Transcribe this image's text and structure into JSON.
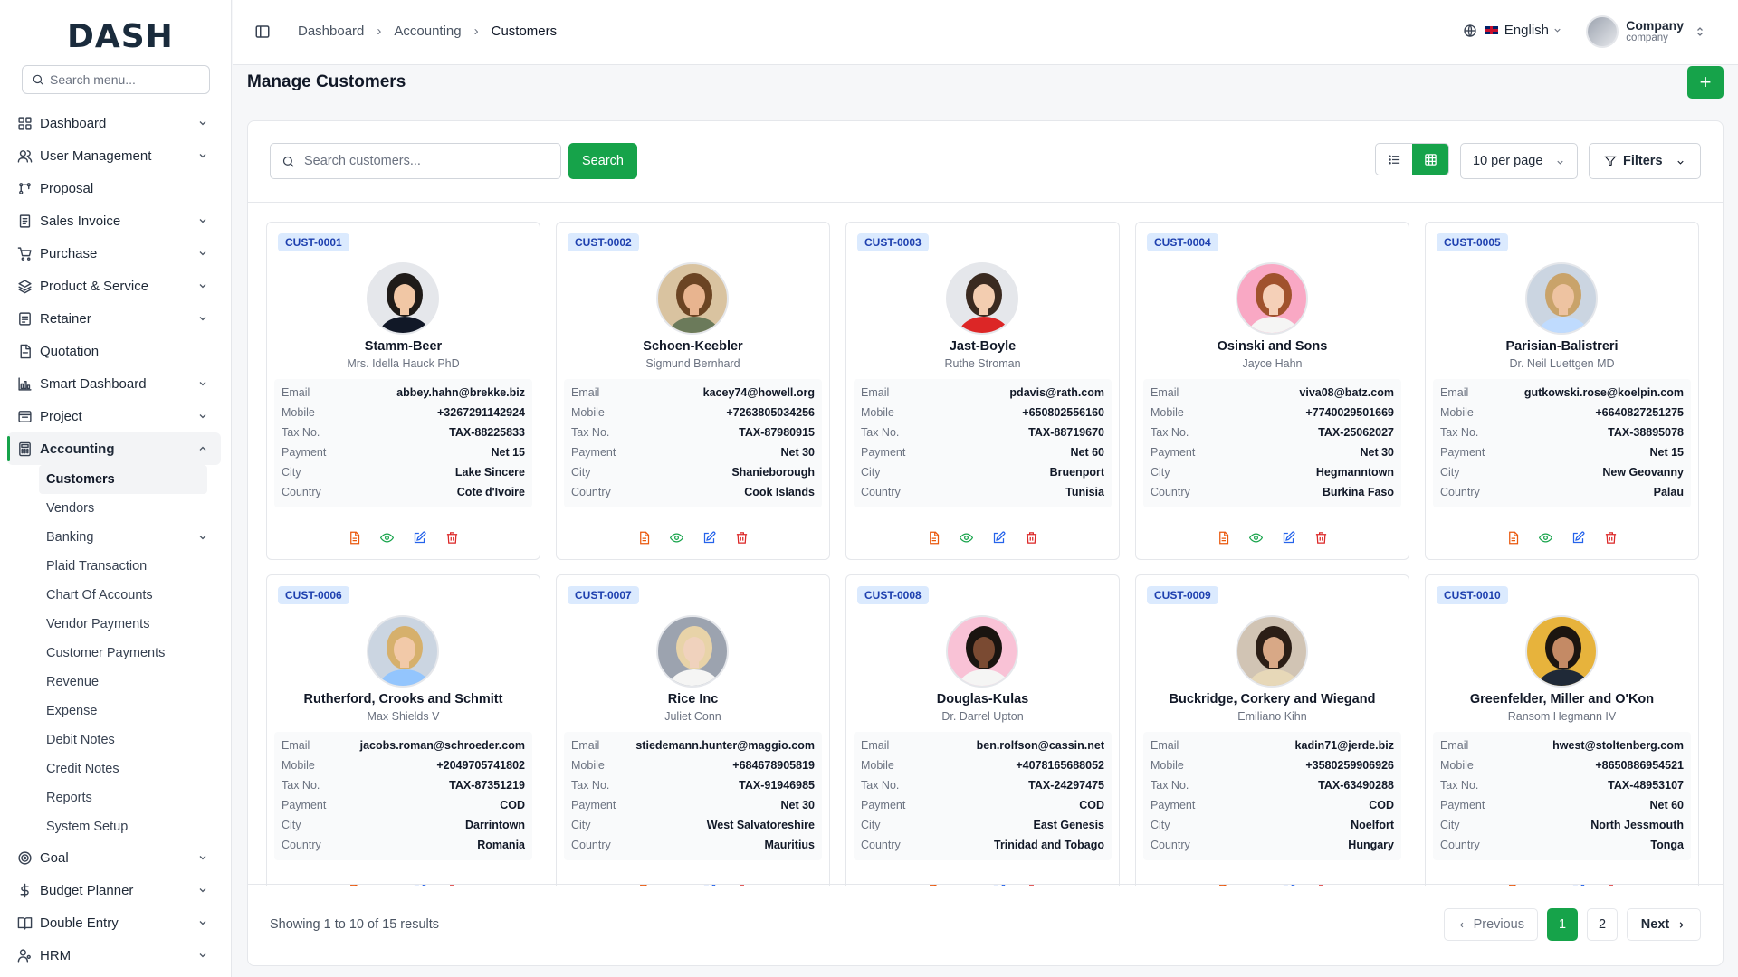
{
  "sidebar": {
    "logo": "DASH",
    "search_placeholder": "Search menu...",
    "items": [
      {
        "label": "Dashboard",
        "icon": "grid-icon",
        "chevron": true
      },
      {
        "label": "User Management",
        "icon": "users-icon",
        "chevron": true
      },
      {
        "label": "Proposal",
        "icon": "proposal-icon",
        "chevron": false
      },
      {
        "label": "Sales Invoice",
        "icon": "invoice-icon",
        "chevron": true
      },
      {
        "label": "Purchase",
        "icon": "cart-icon",
        "chevron": true
      },
      {
        "label": "Product & Service",
        "icon": "layers-icon",
        "chevron": true
      },
      {
        "label": "Retainer",
        "icon": "retainer-icon",
        "chevron": true
      },
      {
        "label": "Quotation",
        "icon": "quotation-icon",
        "chevron": false
      },
      {
        "label": "Smart Dashboard",
        "icon": "chart-icon",
        "chevron": true
      },
      {
        "label": "Project",
        "icon": "project-icon",
        "chevron": true
      },
      {
        "label": "Accounting",
        "icon": "accounting-icon",
        "chevron": true
      }
    ],
    "accounting_sub": [
      {
        "label": "Customers",
        "active": true
      },
      {
        "label": "Vendors"
      },
      {
        "label": "Banking",
        "chevron": true
      },
      {
        "label": "Plaid Transaction"
      },
      {
        "label": "Chart Of Accounts"
      },
      {
        "label": "Vendor Payments"
      },
      {
        "label": "Customer Payments"
      },
      {
        "label": "Revenue"
      },
      {
        "label": "Expense"
      },
      {
        "label": "Debit Notes"
      },
      {
        "label": "Credit Notes"
      },
      {
        "label": "Reports"
      },
      {
        "label": "System Setup"
      }
    ],
    "items_after": [
      {
        "label": "Goal",
        "icon": "goal-icon"
      },
      {
        "label": "Budget Planner",
        "icon": "dollar-icon"
      },
      {
        "label": "Double Entry",
        "icon": "book-icon"
      },
      {
        "label": "HRM",
        "icon": "hrm-icon"
      }
    ]
  },
  "topbar": {
    "breadcrumbs": [
      "Dashboard",
      "Accounting",
      "Customers"
    ],
    "language": "English",
    "company_name": "Company",
    "company_sub": "company"
  },
  "page": {
    "title": "Manage Customers",
    "add_label": "+",
    "search_placeholder": "Search customers...",
    "search_button": "Search",
    "per_page": "10 per page",
    "filters": "Filters"
  },
  "labels": {
    "email": "Email",
    "mobile": "Mobile",
    "tax": "Tax No.",
    "payment": "Payment",
    "city": "City",
    "country": "Country"
  },
  "customers": [
    {
      "id": "CUST-0001",
      "name": "Stamm-Beer",
      "contact": "Mrs. Idella Hauck PhD",
      "email": "abbey.hahn@brekke.biz",
      "mobile": "+3267291142924",
      "tax": "TAX-88225833",
      "payment": "Net 15",
      "city": "Lake Sincere",
      "country": "Cote d'Ivoire"
    },
    {
      "id": "CUST-0002",
      "name": "Schoen-Keebler",
      "contact": "Sigmund Bernhard",
      "email": "kacey74@howell.org",
      "mobile": "+7263805034256",
      "tax": "TAX-87980915",
      "payment": "Net 30",
      "city": "Shanieborough",
      "country": "Cook Islands"
    },
    {
      "id": "CUST-0003",
      "name": "Jast-Boyle",
      "contact": "Ruthe Stroman",
      "email": "pdavis@rath.com",
      "mobile": "+650802556160",
      "tax": "TAX-88719670",
      "payment": "Net 60",
      "city": "Bruenport",
      "country": "Tunisia"
    },
    {
      "id": "CUST-0004",
      "name": "Osinski and Sons",
      "contact": "Jayce Hahn",
      "email": "viva08@batz.com",
      "mobile": "+7740029501669",
      "tax": "TAX-25062027",
      "payment": "Net 30",
      "city": "Hegmanntown",
      "country": "Burkina Faso"
    },
    {
      "id": "CUST-0005",
      "name": "Parisian-Balistreri",
      "contact": "Dr. Neil Luettgen MD",
      "email": "gutkowski.rose@koelpin.com",
      "mobile": "+6640827251275",
      "tax": "TAX-38895078",
      "payment": "Net 15",
      "city": "New Geovanny",
      "country": "Palau"
    },
    {
      "id": "CUST-0006",
      "name": "Rutherford, Crooks and Schmitt",
      "contact": "Max Shields V",
      "email": "jacobs.roman@schroeder.com",
      "mobile": "+2049705741802",
      "tax": "TAX-87351219",
      "payment": "COD",
      "city": "Darrintown",
      "country": "Romania"
    },
    {
      "id": "CUST-0007",
      "name": "Rice Inc",
      "contact": "Juliet Conn",
      "email": "stiedemann.hunter@maggio.com",
      "mobile": "+684678905819",
      "tax": "TAX-91946985",
      "payment": "Net 30",
      "city": "West Salvatoreshire",
      "country": "Mauritius"
    },
    {
      "id": "CUST-0008",
      "name": "Douglas-Kulas",
      "contact": "Dr. Darrel Upton",
      "email": "ben.rolfson@cassin.net",
      "mobile": "+4078165688052",
      "tax": "TAX-24297475",
      "payment": "COD",
      "city": "East Genesis",
      "country": "Trinidad and Tobago"
    },
    {
      "id": "CUST-0009",
      "name": "Buckridge, Corkery and Wiegand",
      "contact": "Emiliano Kihn",
      "email": "kadin71@jerde.biz",
      "mobile": "+3580259906926",
      "tax": "TAX-63490288",
      "payment": "COD",
      "city": "Noelfort",
      "country": "Hungary"
    },
    {
      "id": "CUST-0010",
      "name": "Greenfelder, Miller and O'Kon",
      "contact": "Ransom Hegmann IV",
      "email": "hwest@stoltenberg.com",
      "mobile": "+8650886954521",
      "tax": "TAX-48953107",
      "payment": "Net 60",
      "city": "North Jessmouth",
      "country": "Tonga"
    }
  ],
  "pagination": {
    "showing": "Showing 1 to 10 of 15 results",
    "previous": "Previous",
    "pages": [
      "1",
      "2"
    ],
    "next": "Next"
  },
  "colors": {
    "accent": "#16a34a",
    "badge_bg": "#dbeafe",
    "badge_text": "#1e40af",
    "delete": "#dc2626",
    "invoice": "#ea580c",
    "edit": "#2563eb"
  }
}
